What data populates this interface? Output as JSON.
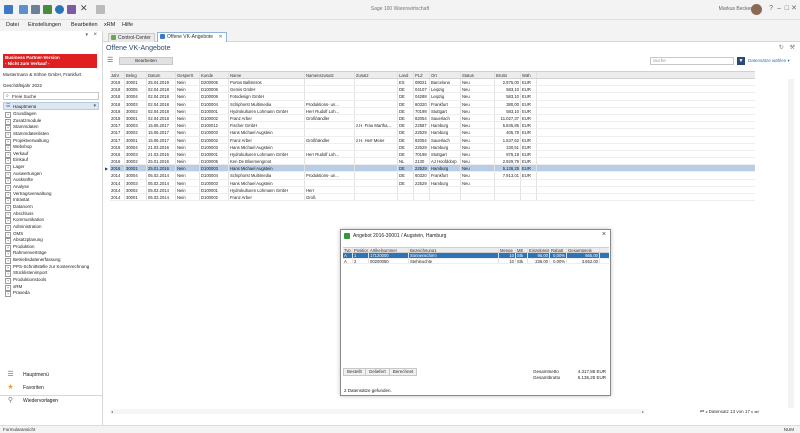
{
  "app": {
    "title": "Sage 100 Warenwirtschaft",
    "user": "Markus Becker",
    "window_controls": [
      "?",
      "–",
      "□",
      "✕"
    ]
  },
  "menu": [
    "Datei",
    "Einstellungen",
    "Bearbeiten",
    "xRM",
    "Hilfe"
  ],
  "left_panel": {
    "promo_line1": "Business Partner-Version",
    "promo_line2": "- Nicht zum Verkauf -",
    "company": "Mustermann & Söhne GmbH, Frankfurt",
    "fiscal_year": "Geschäftsjahr 2022",
    "free_search": "Freie Suche",
    "main_menu": "Hauptmenü",
    "tree": [
      "Grundlagen",
      "Zusatzmodule",
      "Stammdaten",
      "Stammdatenlisten",
      "Projektverwaltung",
      "Webshop",
      "Verkauf",
      "Einkauf",
      "Lager",
      "Auswertungen",
      "Auskünfte",
      "Analyse",
      "Vertragsverwaltung",
      "Intrastat",
      "Datanorm",
      "Abschluss",
      "Kommunikation",
      "Administration",
      "OMS",
      "Absatzplanung",
      "Produktion",
      "Rahmenverträge",
      "Betriebsdatenerfassung",
      "PPS-Schnittstelle zur Kostenrechnung",
      "Stücklistenimport",
      "Produktionstools",
      "xRM",
      "Praxeda"
    ],
    "nav_buttons": [
      {
        "label": "Hauptmenü",
        "icon": "menu-icon"
      },
      {
        "label": "Favoriten",
        "icon": "star-icon"
      },
      {
        "label": "Wiedervorlagen",
        "icon": "paperclip-icon"
      }
    ]
  },
  "tabs": [
    {
      "label": "Control-Center",
      "active": false,
      "color": "#6aa84f"
    },
    {
      "label": "Offene VK-Angebote",
      "active": true,
      "color": "#3c78c3"
    }
  ],
  "page": {
    "title": "Offene VK-Angebote",
    "edit_button": "Bearbeiten",
    "search_placeholder": "Suche",
    "dataset_select": "Datensätze wählen"
  },
  "grid": {
    "columns": [
      "Jahr",
      "Beleg",
      "Datum",
      "Gesperrt",
      "Kunde",
      "Name",
      "Namenszusatz",
      "Zusatz",
      "Land",
      "PLZ",
      "Ort",
      "Status",
      "Brutto",
      "Wäh"
    ],
    "rows": [
      [
        "2019",
        "30001",
        "25.04.2019",
        "Nein",
        "D200005",
        "Portos Ballsteros",
        "",
        "",
        "ES",
        "08021",
        "Barcelona",
        "Neu",
        "2.975,00",
        "EUR"
      ],
      [
        "2018",
        "30005",
        "02.04.2018",
        "Nein",
        "D100006",
        "Gemis GmbH",
        "",
        "",
        "DE",
        "04107",
        "Leipzig",
        "Neu",
        "583,10",
        "EUR"
      ],
      [
        "2018",
        "30004",
        "02.04.2018",
        "Nein",
        "D100006",
        "Fotodesign GmbH",
        "",
        "",
        "DE",
        "04288",
        "Leipzig",
        "Neu",
        "583,10",
        "EUR"
      ],
      [
        "2018",
        "30003",
        "02.04.2018",
        "Nein",
        "D100004",
        "Schiphorst Multimedia",
        "Produktions- un...",
        "",
        "DE",
        "60320",
        "Frankfurt",
        "Neu",
        "380,00",
        "EUR"
      ],
      [
        "2018",
        "30002",
        "02.04.2018",
        "Nein",
        "D100001",
        "Hydrokulturen Lohmann GmbH",
        "Herr Rudolf Loh...",
        "",
        "DE",
        "70198",
        "Stuttgart",
        "Neu",
        "583,10",
        "EUR"
      ],
      [
        "2018",
        "30001",
        "02.04.2018",
        "Nein",
        "D100002",
        "Franz Arber",
        "Großhändler",
        "",
        "DE",
        "82054",
        "Sauerlach",
        "Neu",
        "11.027,37",
        "EUR"
      ],
      [
        "2017",
        "30003",
        "15.06.2017",
        "Nein",
        "D100012",
        "Fischer GmbH",
        "",
        "z.H. Frau Martha...",
        "DE",
        "22587",
        "Hamburg",
        "Neu",
        "5.845,85",
        "EUR"
      ],
      [
        "2017",
        "30002",
        "15.06.2017",
        "Nein",
        "D100003",
        "Hans Michael Augstein",
        "",
        "",
        "DE",
        "22529",
        "Hamburg",
        "Neu",
        "405,78",
        "EUR"
      ],
      [
        "2017",
        "30001",
        "15.06.2017",
        "Nein",
        "D100002",
        "Franz Arber",
        "Großhändler",
        "z.H. Herr Meier",
        "DE",
        "82054",
        "Sauerlach",
        "Neu",
        "1.537,62",
        "EUR"
      ],
      [
        "2016",
        "30004",
        "21.03.2016",
        "Nein",
        "D100003",
        "Hans Michael Augstein",
        "",
        "",
        "DE",
        "22529",
        "Hamburg",
        "Neu",
        "230,51",
        "EUR"
      ],
      [
        "2016",
        "30003",
        "21.03.2016",
        "Nein",
        "D100001",
        "Hydrokulturen Lohmann GmbH",
        "Herr Rudolf Loh...",
        "",
        "DE",
        "70198",
        "Stuttgart",
        "Neu",
        "876,19",
        "EUR"
      ],
      [
        "2016",
        "30002",
        "25.01.2016",
        "Nein",
        "D100005",
        "Ken De Bloemengroot",
        "",
        "",
        "NL",
        "2130",
        "AJ Hoofddorp",
        "Neu",
        "2.929,78",
        "EUR"
      ],
      [
        "2016",
        "30001",
        "25.01.2016",
        "Nein",
        "D100003",
        "Hans Michael Augstein",
        "",
        "",
        "DE",
        "22529",
        "Hamburg",
        "Neu",
        "5.136,25",
        "EUR"
      ],
      [
        "2014",
        "30004",
        "05.02.2014",
        "Nein",
        "D100004",
        "Schiphorst Multimedia",
        "Produktions- un...",
        "",
        "DE",
        "60320",
        "Frankfurt",
        "Neu",
        "7.913,01",
        "EUR"
      ],
      [
        "2014",
        "30003",
        "05.02.2014",
        "Nein",
        "D100003",
        "Hans Michael Augstein",
        "",
        "",
        "DE",
        "22529",
        "Hamburg",
        "Neu",
        "",
        ""
      ],
      [
        "2014",
        "30002",
        "05.02.2014",
        "Nein",
        "D100001",
        "Hydrokulturen Lohmann GmbH",
        "Herr",
        "",
        "",
        "",
        "",
        "",
        "",
        ""
      ],
      [
        "2014",
        "30001",
        "05.02.2014",
        "Nein",
        "D100002",
        "Franz Arber",
        "Groß",
        "",
        "",
        "",
        "",
        "",
        "",
        ""
      ]
    ],
    "selected_row": 12,
    "pager": "Datensatz 13 von 17"
  },
  "dialog": {
    "title": "Angebot 2016-30001 / Augstein, Hamburg",
    "columns": [
      "Typ",
      "Position",
      "Artikelnummer",
      "Bezeichnung1",
      "Menge",
      "ME",
      "Einzelpreis",
      "Rabatt",
      "Gesamtpreis"
    ],
    "rows": [
      [
        "A",
        "1",
        "17120000",
        "Sonnenschirm",
        "10",
        "Stk",
        "95,00",
        "0,00%",
        "665,00"
      ],
      [
        "A",
        "2",
        "00200050",
        "Stehleuchte",
        "10",
        "Stk",
        "236,00",
        "0,00%",
        "3.652,00"
      ]
    ],
    "selected_row": 0,
    "tabs": [
      "Bestellt",
      "Geliefert",
      "Berechnet"
    ],
    "totals": [
      {
        "label": "Gesamtnetto",
        "value": "4.317,86 EUR"
      },
      {
        "label": "Gesamtbrutto",
        "value": "5.136,25 EUR"
      }
    ],
    "count_text": "2 Datensätze gefunden."
  },
  "status": {
    "left": "Formularansicht",
    "right": "NUM"
  }
}
